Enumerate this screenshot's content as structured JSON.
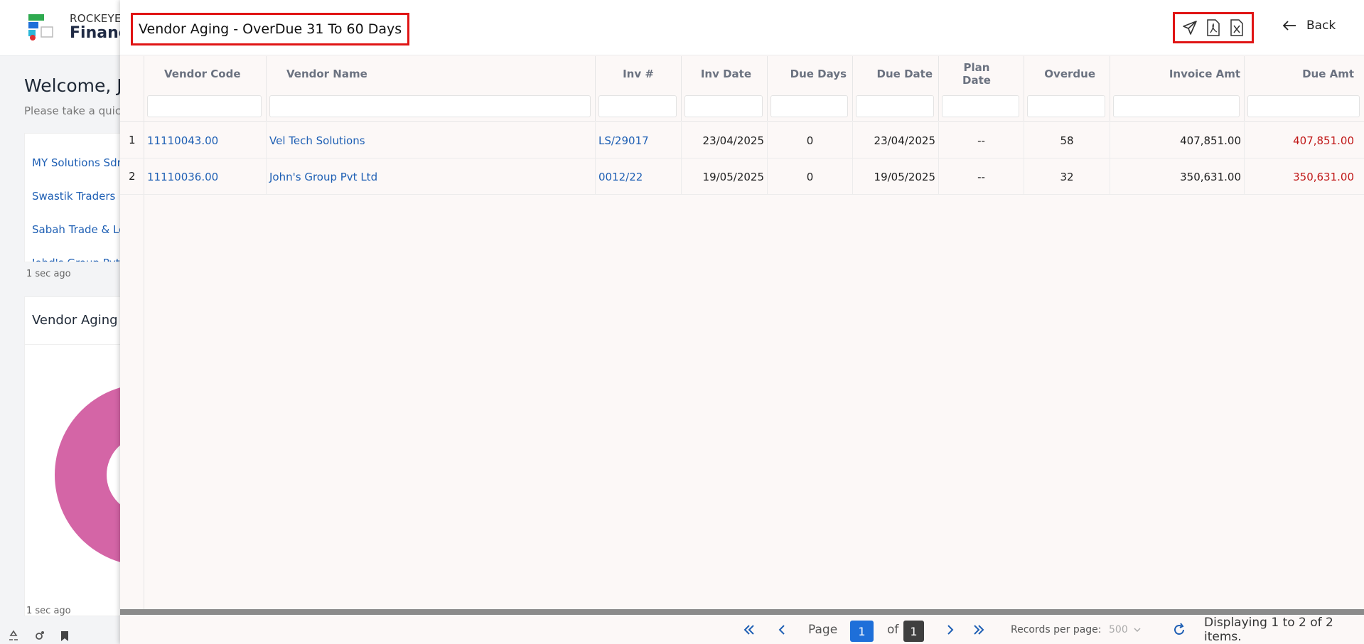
{
  "background": {
    "brand_top": "ROCKEYE",
    "brand_main": "Financ",
    "welcome": "Welcome, Jo",
    "welcome_sub": "Please take a quick",
    "vendor_list": [
      "MY Solutions Sdn",
      "Swastik Traders",
      "Sabah Trade & Lo",
      "Johd's Group Pvt"
    ],
    "updated_1": "1 sec ago",
    "chart_card_title": "Vendor Aging",
    "updated_2": "1 sec ago",
    "donut_color": "#d465a6"
  },
  "modal": {
    "title": "Vendor Aging - OverDue 31 To 60 Days",
    "back_label": "Back",
    "actions": [
      "send-icon",
      "pdf-icon",
      "excel-icon"
    ],
    "highlight_color": "#e01414"
  },
  "table": {
    "columns": [
      "Vendor Code",
      "Vendor Name",
      "Inv #",
      "Inv Date",
      "Due Days",
      "Due Date",
      "Plan Date",
      "Overdue",
      "Invoice Amt",
      "Due Amt"
    ],
    "rows": [
      {
        "n": "1",
        "vendor_code": "11110043.00",
        "vendor_name": "Vel Tech Solutions",
        "inv_no": "LS/29017",
        "inv_date": "23/04/2025",
        "due_days": "0",
        "due_date": "23/04/2025",
        "plan_date": "--",
        "overdue": "58",
        "invoice_amt": "407,851.00",
        "due_amt": "407,851.00"
      },
      {
        "n": "2",
        "vendor_code": "11110036.00",
        "vendor_name": "John's Group Pvt Ltd",
        "inv_no": "0012/22",
        "inv_date": "19/05/2025",
        "due_days": "0",
        "due_date": "19/05/2025",
        "plan_date": "--",
        "overdue": "32",
        "invoice_amt": "350,631.00",
        "due_amt": "350,631.00"
      }
    ]
  },
  "pager": {
    "page_label": "Page",
    "current_page": "1",
    "of_label": "of",
    "total_pages": "1",
    "records_label": "Records per page:",
    "records_value": "500",
    "summary": "Displaying 1 to 2 of 2 items."
  }
}
